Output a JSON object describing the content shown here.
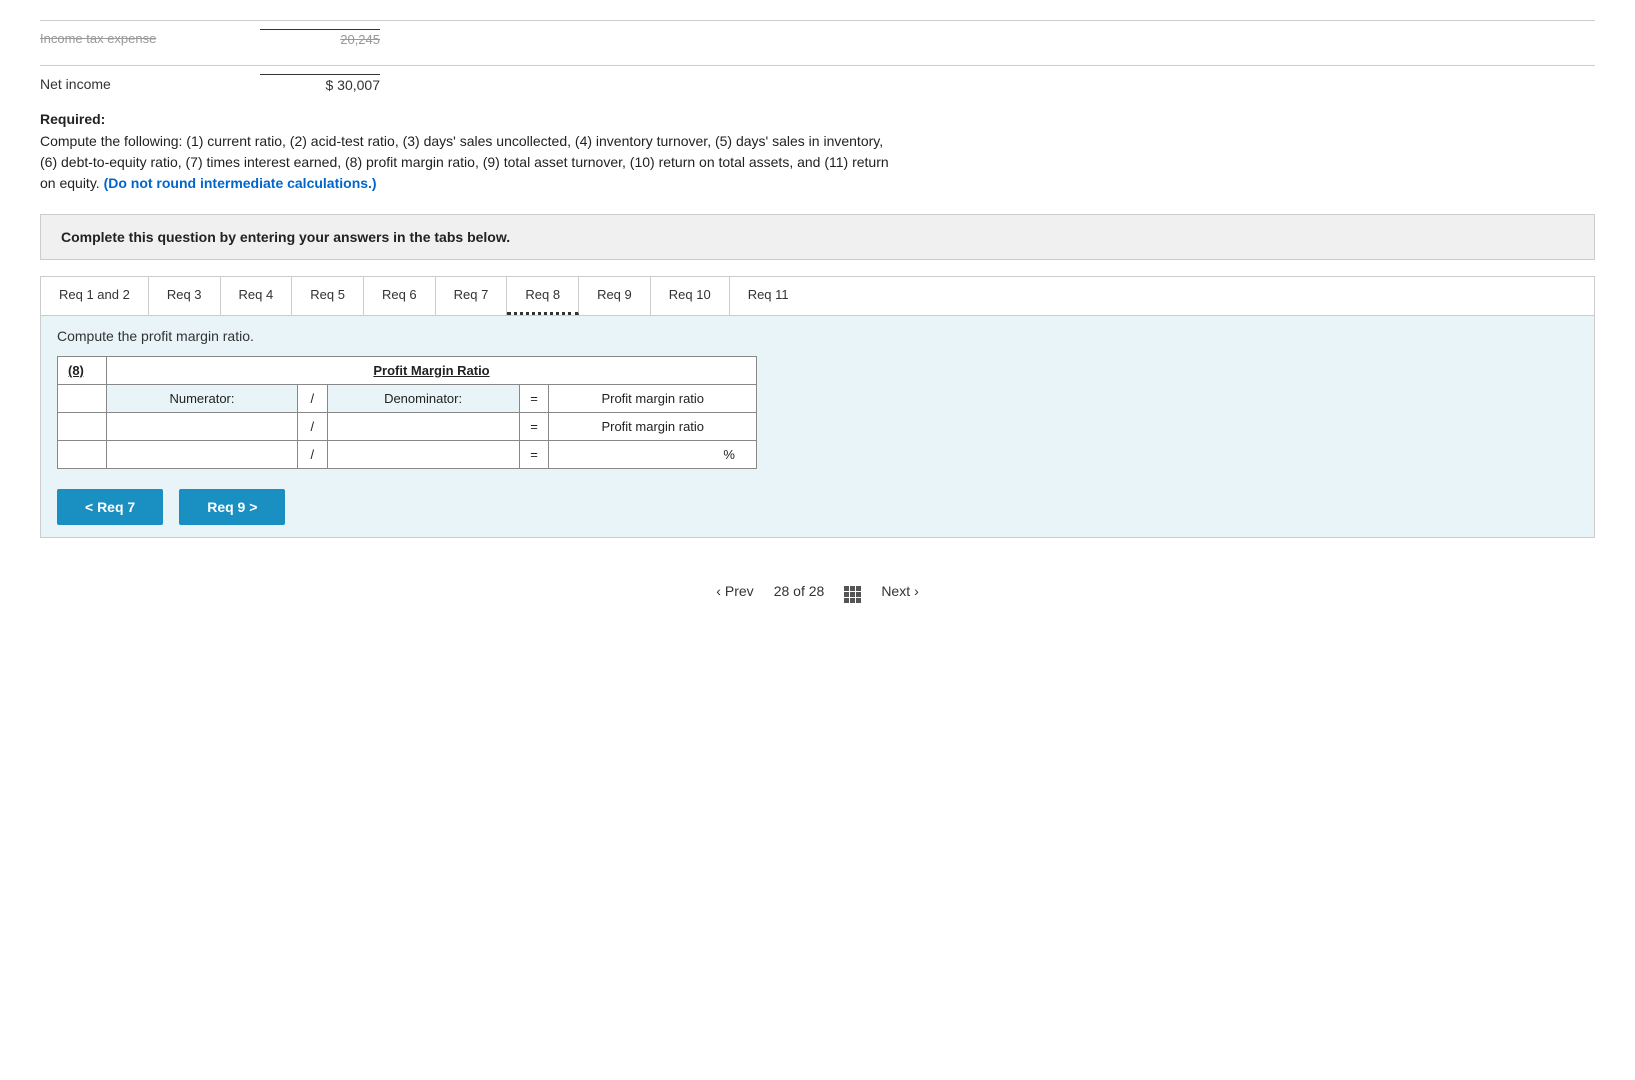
{
  "top": {
    "income_tax_label": "Income tax expense",
    "income_tax_value": "20,245",
    "net_income_label": "Net income",
    "net_income_value": "$ 30,007"
  },
  "required": {
    "title": "Required:",
    "text1": "Compute the following: (1) current ratio, (2) acid-test ratio, (3) days' sales uncollected, (4) inventory turnover, (5) days' sales in inventory,",
    "text2": "(6) debt-to-equity ratio, (7) times interest earned, (8) profit margin ratio, (9) total asset turnover, (10) return on total assets, and (11) return",
    "text3": "on equity.",
    "highlight": "(Do not round intermediate calculations.)"
  },
  "complete_box": {
    "text": "Complete this question by entering your answers in the tabs below."
  },
  "tabs": [
    {
      "label": "Req 1 and 2",
      "active": false
    },
    {
      "label": "Req 3",
      "active": false
    },
    {
      "label": "Req 4",
      "active": false
    },
    {
      "label": "Req 5",
      "active": false
    },
    {
      "label": "Req 6",
      "active": false
    },
    {
      "label": "Req 7",
      "active": false
    },
    {
      "label": "Req 8",
      "active": true
    },
    {
      "label": "Req 9",
      "active": false
    },
    {
      "label": "Req 10",
      "active": false
    },
    {
      "label": "Req 11",
      "active": false
    }
  ],
  "tab_content": {
    "instruction": "Compute the profit margin ratio.",
    "table": {
      "row_number": "(8)",
      "title": "Profit Margin Ratio",
      "headers": {
        "numerator": "Numerator:",
        "slash": "/",
        "denominator": "Denominator:",
        "equals": "=",
        "result": "Profit margin ratio"
      },
      "row1": {
        "slash": "/",
        "equals": "=",
        "result_label": "Profit margin ratio"
      },
      "row2": {
        "slash": "/",
        "equals": "=",
        "percent": "%"
      }
    }
  },
  "nav_buttons": {
    "prev_label": "< Req 7",
    "next_label": "Req 9 >"
  },
  "bottom_nav": {
    "prev_label": "Prev",
    "page_current": "28",
    "page_total": "28",
    "of_label": "of",
    "next_label": "Next"
  }
}
